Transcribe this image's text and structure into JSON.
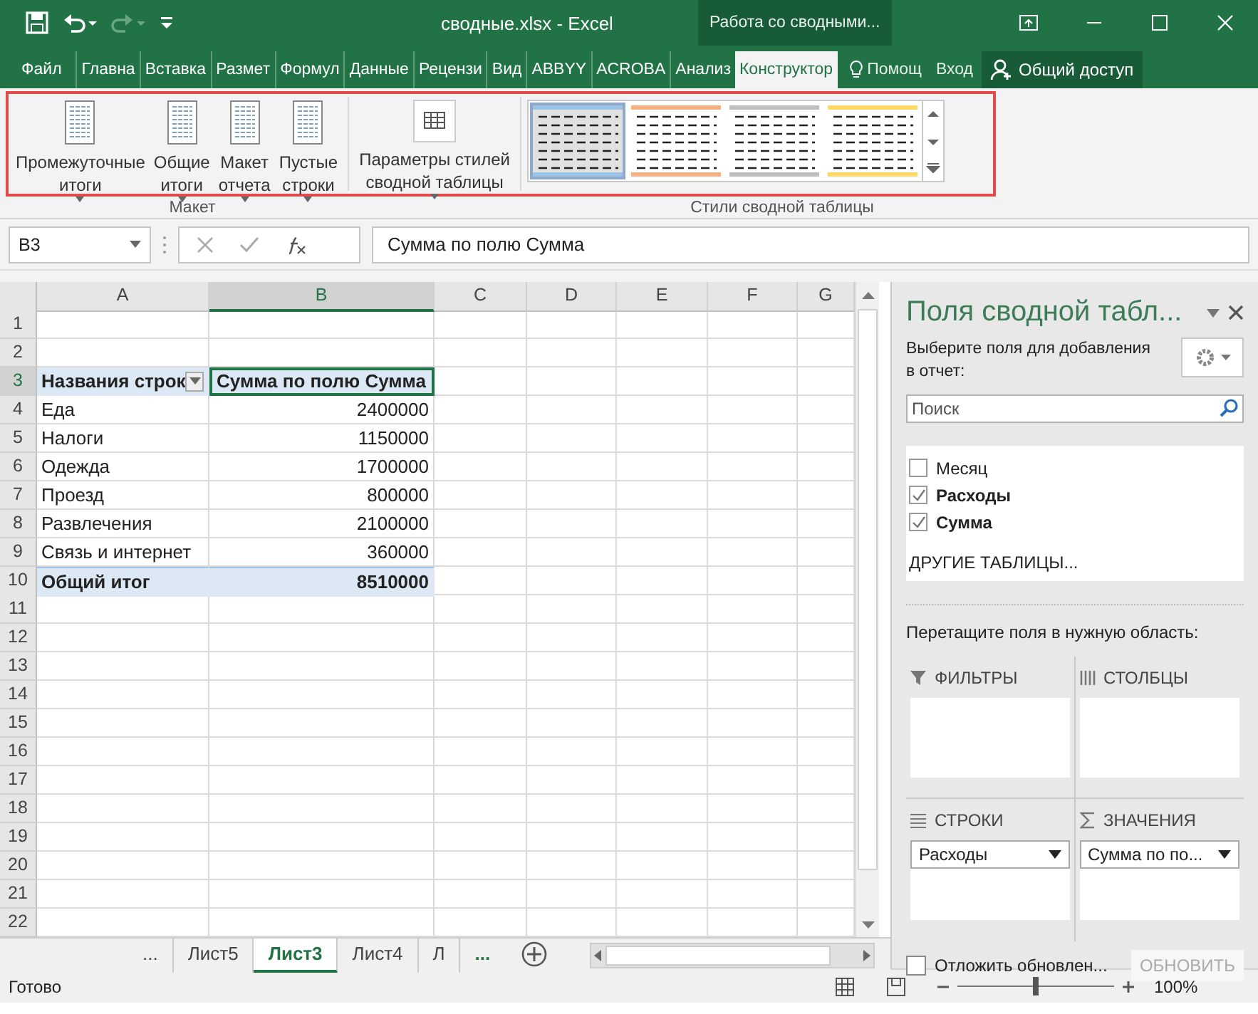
{
  "window": {
    "title": "сводные.xlsx - Excel",
    "context_tab": "Работа со сводными..."
  },
  "ribbon_tabs": [
    {
      "label": "Файл",
      "selected": false
    },
    {
      "label": "Главна",
      "selected": false
    },
    {
      "label": "Вставка",
      "selected": false
    },
    {
      "label": "Размет",
      "selected": false
    },
    {
      "label": "Формул",
      "selected": false
    },
    {
      "label": "Данные",
      "selected": false
    },
    {
      "label": "Рецензи",
      "selected": false
    },
    {
      "label": "Вид",
      "selected": false
    },
    {
      "label": "ABBYY",
      "selected": false
    },
    {
      "label": "ACROBA",
      "selected": false
    },
    {
      "label": "Анализ",
      "selected": false
    },
    {
      "label": "Конструктор",
      "selected": true
    }
  ],
  "help": "Помощ",
  "sign_in": "Вход",
  "share": "Общий доступ",
  "ribbon_groups": [
    {
      "label": "Макет",
      "buttons": [
        {
          "label": "Промежуточные\nитоги",
          "kind": "subtotals"
        },
        {
          "label": "Общие\nитоги",
          "kind": "totals"
        },
        {
          "label": "Макет\nотчета",
          "kind": "layout"
        },
        {
          "label": "Пустые\nстроки",
          "kind": "blank"
        }
      ]
    },
    {
      "buttons": [
        {
          "label": "Параметры стилей\nсводной таблицы",
          "kind": "options"
        }
      ]
    },
    {
      "label": "Стили сводной таблицы",
      "styles": [
        {
          "color": "#9dc3e6",
          "selected": true
        },
        {
          "color": "#f4b183",
          "selected": false
        },
        {
          "color": "#bfbfbf",
          "selected": false
        },
        {
          "color": "#ffd966",
          "selected": false
        }
      ]
    }
  ],
  "formula_bar": {
    "name_box": "B3",
    "formula": "Сумма по полю Сумма"
  },
  "columns": [
    {
      "label": "A",
      "selected": false
    },
    {
      "label": "B",
      "selected": true
    },
    {
      "label": "C",
      "selected": false
    },
    {
      "label": "D",
      "selected": false
    },
    {
      "label": "E",
      "selected": false
    },
    {
      "label": "F",
      "selected": false
    },
    {
      "label": "G",
      "selected": false
    }
  ],
  "rows": [
    {
      "number": "1",
      "kind": "blank"
    },
    {
      "number": "2",
      "kind": "blank"
    },
    {
      "number": "3",
      "kind": "header",
      "label": "Названия строк",
      "value": "Сумма по полю Сумма"
    },
    {
      "number": "4",
      "kind": "item",
      "label": "Еда",
      "value": "2400000"
    },
    {
      "number": "5",
      "kind": "item",
      "label": "Налоги",
      "value": "1150000"
    },
    {
      "number": "6",
      "kind": "item",
      "label": "Одежда",
      "value": "1700000"
    },
    {
      "number": "7",
      "kind": "item",
      "label": "Проезд",
      "value": "800000"
    },
    {
      "number": "8",
      "kind": "item",
      "label": "Развлечения",
      "value": "2100000"
    },
    {
      "number": "9",
      "kind": "item",
      "label": "Связь и интернет",
      "value": "360000"
    },
    {
      "number": "10",
      "kind": "total",
      "label": "Общий итог",
      "value": "8510000"
    },
    {
      "number": "11",
      "kind": "blank"
    },
    {
      "number": "12",
      "kind": "blank"
    },
    {
      "number": "13",
      "kind": "blank"
    },
    {
      "number": "14",
      "kind": "blank"
    },
    {
      "number": "15",
      "kind": "blank"
    },
    {
      "number": "16",
      "kind": "blank"
    },
    {
      "number": "17",
      "kind": "blank"
    },
    {
      "number": "18",
      "kind": "blank"
    },
    {
      "number": "19",
      "kind": "blank"
    },
    {
      "number": "20",
      "kind": "blank"
    },
    {
      "number": "21",
      "kind": "blank"
    },
    {
      "number": "22",
      "kind": "blank"
    }
  ],
  "sheet_tabs": [
    {
      "label": "...",
      "selected": false
    },
    {
      "label": "Лист5",
      "selected": false
    },
    {
      "label": "Лист3",
      "selected": true
    },
    {
      "label": "Лист4",
      "selected": false
    },
    {
      "label": "Л",
      "selected": false
    },
    {
      "label": "...",
      "selected": false
    }
  ],
  "status_bar": {
    "text": "Готово",
    "zoom": "100%",
    "zoom_level": {
      "level": 0.5
    }
  },
  "pane": {
    "title": "Поля сводной табл...",
    "instruction": "Выберите поля для добавления в отчет:",
    "search": {
      "placeholder": "Поиск"
    },
    "fields": [
      {
        "label": "Месяц",
        "checked": false
      },
      {
        "label": "Расходы",
        "checked": true
      },
      {
        "label": "Сумма",
        "checked": true
      }
    ],
    "more_tables": "ДРУГИЕ ТАБЛИЦЫ...",
    "drag_hint": "Перетащите поля в нужную область:",
    "areas": [
      {
        "title": "ФИЛЬТРЫ",
        "kind": "filter"
      },
      {
        "title": "СТОЛБЦЫ",
        "kind": "columns"
      },
      {
        "title": "СТРОКИ",
        "kind": "rows",
        "items": [
          "Расходы"
        ]
      },
      {
        "title": "ЗНАЧЕНИЯ",
        "kind": "values",
        "items": [
          "Сумма по по..."
        ]
      }
    ],
    "defer": {
      "label": "Отложить обновлен...",
      "checked": false
    },
    "update": {
      "label": "ОБНОВИТЬ",
      "disabled": true
    }
  }
}
